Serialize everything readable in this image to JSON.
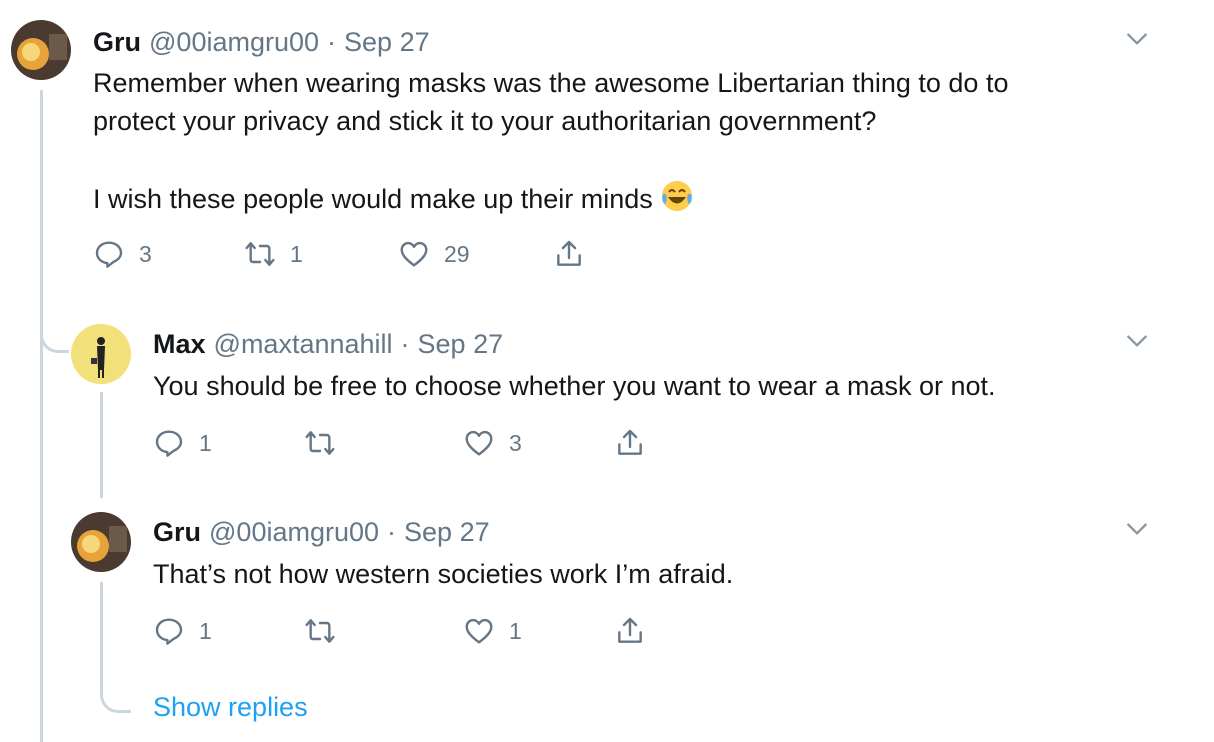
{
  "tweets": [
    {
      "name": "Gru",
      "handle": "@00iamgru00",
      "date": "Sep 27",
      "text_lines": [
        "Remember when wearing masks was the awesome Libertarian thing to do to",
        "protect your privacy and stick it to your authoritarian government?"
      ],
      "text_line3": "I wish these people would make up their minds",
      "emoji": "face-with-tears-of-joy",
      "replies": "3",
      "retweets": "1",
      "likes": "29"
    },
    {
      "name": "Max",
      "handle": "@maxtannahill",
      "date": "Sep 27",
      "text": "You should be free to choose whether you want to wear a mask or not.",
      "replies": "1",
      "retweets": "",
      "likes": "3"
    },
    {
      "name": "Gru",
      "handle": "@00iamgru00",
      "date": "Sep 27",
      "text": "That’s not how western societies work I’m afraid.",
      "replies": "1",
      "retweets": "",
      "likes": "1"
    }
  ],
  "show_replies_label": "Show replies",
  "separator": "·",
  "colors": {
    "link": "#1da1f2",
    "secondary": "#657786",
    "thread": "#ccd6dd"
  }
}
